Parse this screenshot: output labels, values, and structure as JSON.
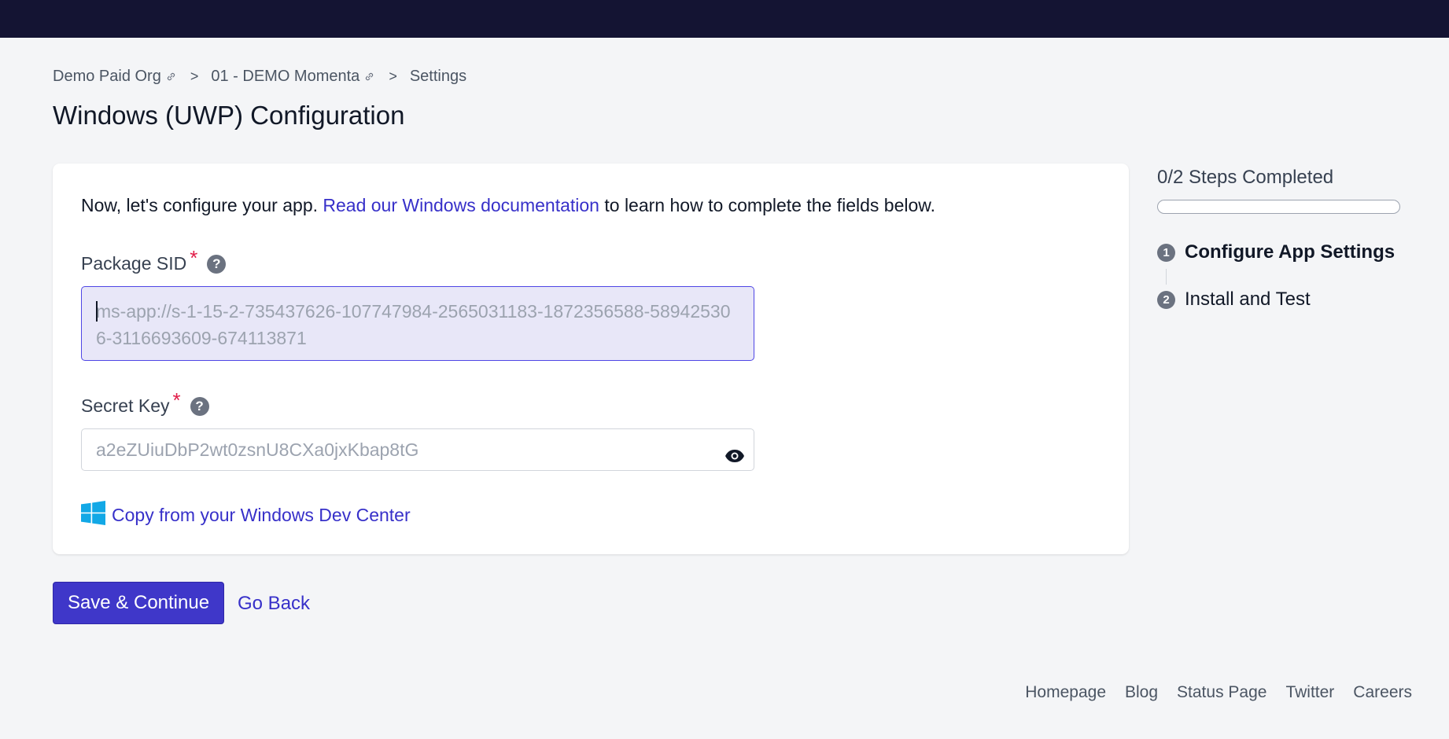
{
  "breadcrumb": {
    "items": [
      {
        "label": "Demo Paid Org"
      },
      {
        "label": "01 - DEMO Momenta"
      },
      {
        "label": "Settings"
      }
    ],
    "separator": ">"
  },
  "page": {
    "title": "Windows (UWP) Configuration"
  },
  "intro": {
    "before": "Now, let's configure your app. ",
    "link": "Read our Windows documentation",
    "after": " to learn how to complete the fields below."
  },
  "fields": {
    "package_sid": {
      "label": "Package SID",
      "required_mark": "*",
      "help": "?",
      "placeholder": "ms-app://s-1-15-2-735437626-107747984-2565031183-1872356588-589425306-3116693609-674113871",
      "value": ""
    },
    "secret_key": {
      "label": "Secret Key",
      "required_mark": "*",
      "help": "?",
      "placeholder": "a2eZUiuDbP2wt0zsnU8CXa0jxKbap8tG",
      "value": ""
    }
  },
  "dev_center_link": {
    "label": "Copy from your Windows Dev Center",
    "icon": "windows-logo-icon"
  },
  "actions": {
    "save": "Save & Continue",
    "back": "Go Back"
  },
  "steps": {
    "summary": "0/2 Steps Completed",
    "completed": 0,
    "total": 2,
    "items": [
      {
        "number": "1",
        "label": "Configure App Settings",
        "active": true
      },
      {
        "number": "2",
        "label": "Install and Test",
        "active": false
      }
    ]
  },
  "footer": {
    "links": [
      "Homepage",
      "Blog",
      "Status Page",
      "Twitter",
      "Careers"
    ]
  },
  "colors": {
    "accent": "#3f37c9",
    "topbar": "#141433",
    "required": "#e11d48",
    "link": "#3730c9"
  }
}
